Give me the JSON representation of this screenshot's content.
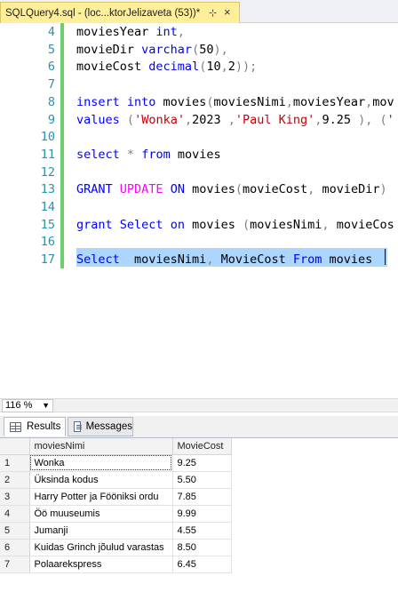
{
  "tab": {
    "title": "SQLQuery4.sql - (loc...ktorJelizaveta (53))*",
    "pin_icon": "pin-icon",
    "close_icon": "close-icon"
  },
  "editor": {
    "line_numbers": [
      "4",
      "5",
      "6",
      "7",
      "8",
      "9",
      "10",
      "11",
      "12",
      "13",
      "14",
      "15",
      "16",
      "17"
    ]
  },
  "zoom": {
    "value": "116 %"
  },
  "results_tabs": {
    "results_label": "Results",
    "messages_label": "Messages"
  },
  "results": {
    "columns": [
      "moviesNimi",
      "MovieCost"
    ],
    "rows": [
      [
        "1",
        "Wonka",
        "9.25"
      ],
      [
        "2",
        "Üksinda kodus",
        "5.50"
      ],
      [
        "3",
        "Harry Potter ja Fööniksi ordu",
        "7.85"
      ],
      [
        "4",
        "Öö muuseumis",
        "9.99"
      ],
      [
        "5",
        "Jumanji",
        "4.55"
      ],
      [
        "6",
        "Kuidas Grinch jõulud varastas",
        "8.50"
      ],
      [
        "7",
        "Polaarekspress",
        "6.45"
      ]
    ]
  }
}
